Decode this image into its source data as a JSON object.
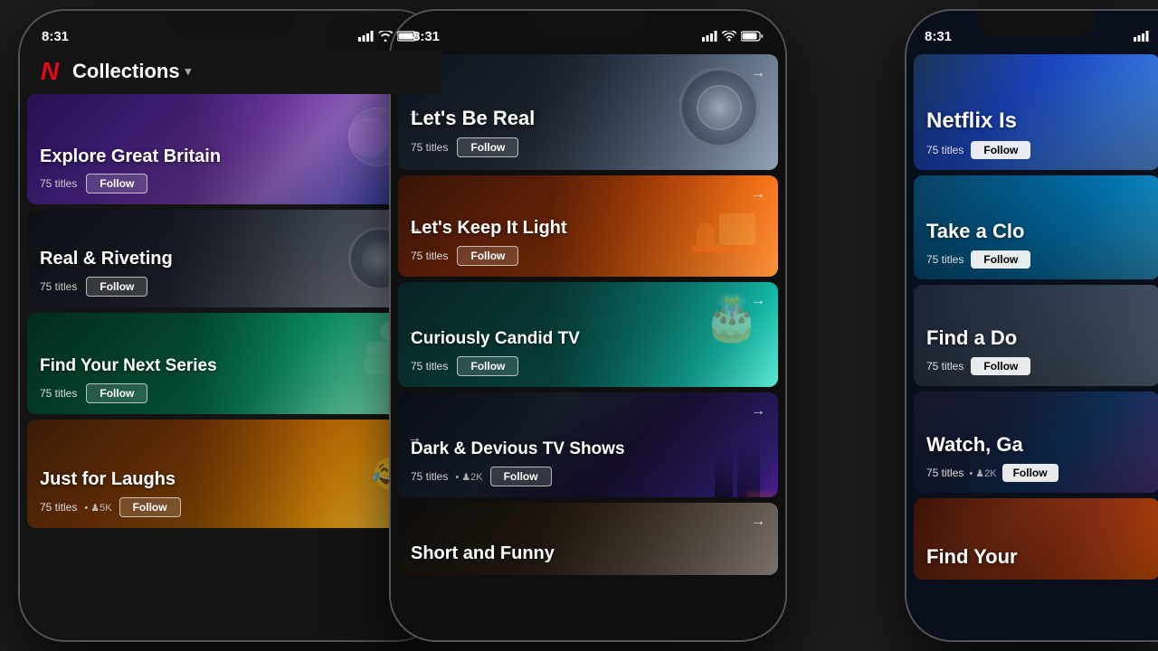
{
  "phone1": {
    "status": {
      "time": "8:31",
      "location": "↗"
    },
    "header": {
      "title": "Collections",
      "chevron": "▾"
    },
    "cards": [
      {
        "id": "great-britain",
        "title": "Explore Great Britain",
        "titles_count": "75 titles",
        "follow_label": "Follow",
        "has_arrow": true
      },
      {
        "id": "riveting",
        "title": "Real & Riveting",
        "titles_count": "75 titles",
        "follow_label": "Follow",
        "has_arrow": true
      },
      {
        "id": "next-series",
        "title": "Find Your Next Series",
        "titles_count": "75 titles",
        "follow_label": "Follow",
        "has_arrow": true
      },
      {
        "id": "laughs",
        "title": "Just for Laughs",
        "titles_count": "75 titles",
        "followers": "♟5K",
        "follow_label": "Follow",
        "has_arrow": true
      }
    ]
  },
  "phone2": {
    "status": {
      "time": "8:31",
      "location": "↗"
    },
    "cards": [
      {
        "id": "lets-be-real",
        "title": "Let's Be Real",
        "titles_count": "75 titles",
        "follow_label": "Follow",
        "has_arrow": true
      },
      {
        "id": "keep-light",
        "title": "Let's Keep It Light",
        "titles_count": "75 titles",
        "follow_label": "Follow",
        "has_arrow": true
      },
      {
        "id": "candid-tv",
        "title": "Curiously Candid TV",
        "titles_count": "75 titles",
        "follow_label": "Follow",
        "has_arrow": true
      },
      {
        "id": "dark-devious",
        "title": "Dark & Devious TV Shows",
        "titles_count": "75 titles",
        "followers": "♟2K",
        "follow_label": "Follow",
        "has_arrow": true
      },
      {
        "id": "short-funny",
        "title": "Short and Funny",
        "titles_count": "",
        "follow_label": "",
        "has_arrow": true
      }
    ]
  },
  "phone3": {
    "status": {
      "time": "8:31",
      "location": "↗"
    },
    "cards": [
      {
        "id": "netflix-is",
        "title": "Netflix Is",
        "titles_count": "75 titles",
        "follow_label": "Follow",
        "has_arrow": false
      },
      {
        "id": "take-clo",
        "title": "Take a Clo",
        "titles_count": "75 titles",
        "follow_label": "Follow",
        "has_arrow": false
      },
      {
        "id": "find-doc",
        "title": "Find a Do",
        "titles_count": "75 titles",
        "follow_label": "Follow",
        "has_arrow": false
      },
      {
        "id": "watch-ga",
        "title": "Watch, Ga",
        "titles_count": "75 titles",
        "followers": "♟2K",
        "follow_label": "Follow",
        "has_arrow": false
      },
      {
        "id": "find-your-3",
        "title": "Find Your",
        "titles_count": "",
        "follow_label": "",
        "has_arrow": false
      }
    ]
  }
}
